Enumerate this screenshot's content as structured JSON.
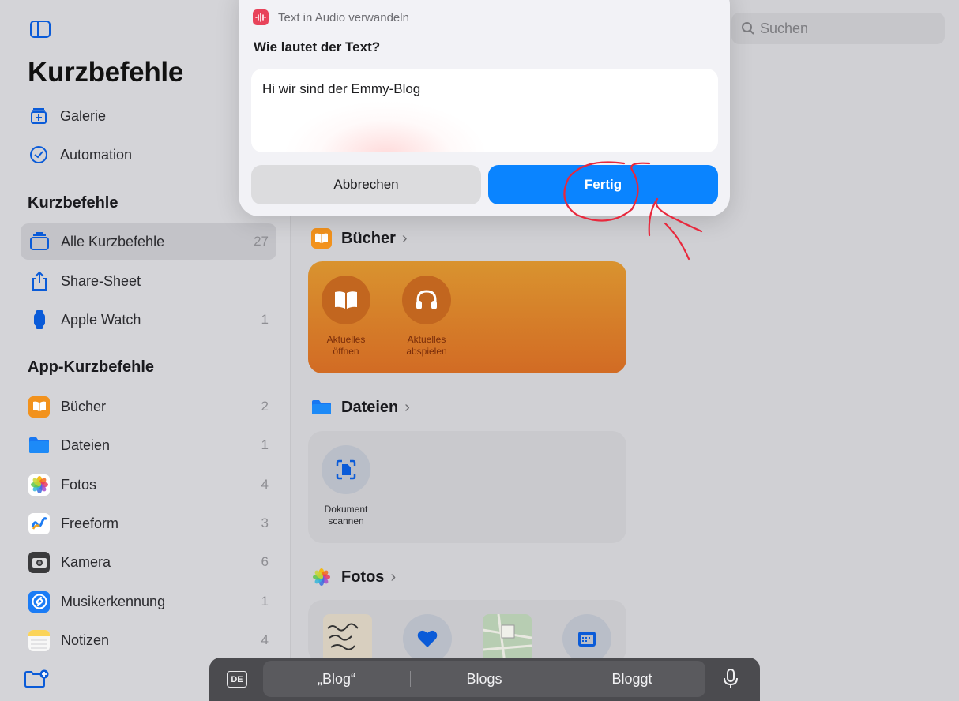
{
  "sidebar": {
    "title": "Kurzbefehle",
    "top_links": [
      {
        "label": "Galerie",
        "icon": "gallery-icon"
      },
      {
        "label": "Automation",
        "icon": "clock-check-icon"
      }
    ],
    "shortcuts_header": "Kurzbefehle",
    "shortcuts": [
      {
        "label": "Alle Kurzbefehle",
        "count": "27",
        "selected": true,
        "icon": "stack-icon"
      },
      {
        "label": "Share-Sheet",
        "count": "",
        "icon": "share-icon"
      },
      {
        "label": "Apple Watch",
        "count": "1",
        "icon": "watch-icon"
      }
    ],
    "app_header": "App-Kurzbefehle",
    "apps": [
      {
        "label": "Bücher",
        "count": "2",
        "icon": "books-app-icon",
        "color": "#f2921d"
      },
      {
        "label": "Dateien",
        "count": "1",
        "icon": "files-app-icon",
        "color": "#1877f2"
      },
      {
        "label": "Fotos",
        "count": "4",
        "icon": "photos-app-icon",
        "color": "#ffffff"
      },
      {
        "label": "Freeform",
        "count": "3",
        "icon": "freeform-app-icon",
        "color": "#ffffff"
      },
      {
        "label": "Kamera",
        "count": "6",
        "icon": "camera-app-icon",
        "color": "#3a3a3c"
      },
      {
        "label": "Musikerkennung",
        "count": "1",
        "icon": "shazam-app-icon",
        "color": "#1b7cf5"
      },
      {
        "label": "Notizen",
        "count": "4",
        "icon": "notes-app-icon",
        "color": "#fbe27a"
      }
    ]
  },
  "search": {
    "placeholder": "Suchen"
  },
  "groups": {
    "books": {
      "title": "Bücher",
      "actions": [
        {
          "label1": "Aktuelles",
          "label2": "öffnen"
        },
        {
          "label1": "Aktuelles",
          "label2": "abspielen"
        }
      ]
    },
    "files": {
      "title": "Dateien",
      "actions": [
        {
          "label1": "Dokument",
          "label2": "scannen"
        }
      ]
    },
    "photos": {
      "title": "Fotos"
    }
  },
  "dialog": {
    "app_name": "Text in Audio verwandeln",
    "question": "Wie lautet der Text?",
    "text_value": "Hi wir sind der Emmy-Blog",
    "cancel_label": "Abbrechen",
    "done_label": "Fertig"
  },
  "keyboard": {
    "language": "DE",
    "suggestions": [
      "„Blog“",
      "Blogs",
      "Bloggt"
    ]
  },
  "colors": {
    "accent": "#0a84ff",
    "annotation": "#e8283c"
  }
}
